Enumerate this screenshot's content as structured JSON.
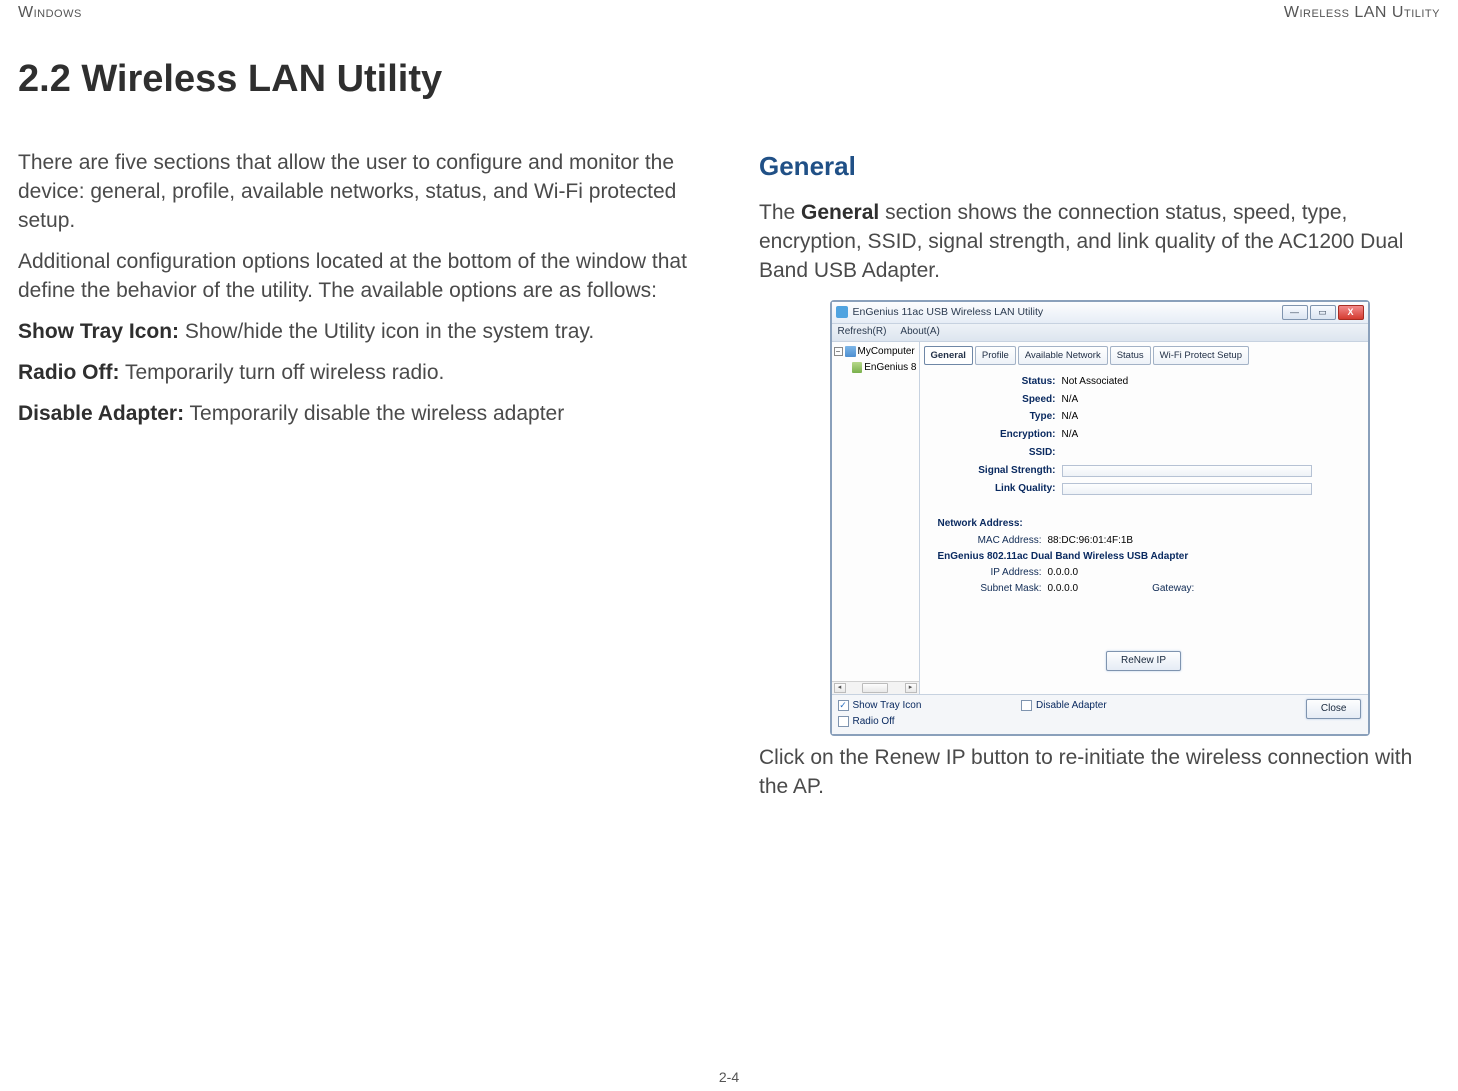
{
  "header": {
    "left": "Windows",
    "right": "Wireless LAN Utility"
  },
  "title": "2.2 Wireless LAN Utility",
  "left_col": {
    "intro": "There are five sections that allow the user to configure and monitor the device: general, profile, available networks, status, and Wi-Fi protected setup.",
    "additional": "Additional configuration options located at the bottom of the window that define the behavior of the utility. The available options are as follows:",
    "opt1_label": "Show Tray Icon:",
    "opt1_text": " Show/hide the Utility icon in the system tray.",
    "opt2_label": "Radio Off:",
    "opt2_text": " Temporarily turn off wireless radio.",
    "opt3_label": "Disable Adapter:",
    "opt3_text": " Temporarily disable the wireless adapter"
  },
  "right_col": {
    "heading": "General",
    "desc_pre": "The ",
    "desc_bold": "General",
    "desc_post": " section shows the connection status, speed, type, encryption, SSID, signal strength, and link quality of the AC1200 Dual Band USB Adapter.",
    "caption": "Click on the Renew IP button to re-initiate the wireless connection with the AP."
  },
  "window": {
    "title": "EnGenius 11ac USB Wireless LAN Utility",
    "menu": {
      "refresh": "Refresh(R)",
      "about": "About(A)"
    },
    "win_controls": {
      "min": "—",
      "max": "▭",
      "close": "X"
    },
    "tree": {
      "root_toggle": "−",
      "root": "MyComputer",
      "child": "EnGenius 8"
    },
    "scroll": {
      "left": "◂",
      "right": "▸"
    },
    "tabs": [
      "General",
      "Profile",
      "Available Network",
      "Status",
      "Wi-Fi Protect Setup"
    ],
    "status": {
      "Status": "Not Associated",
      "Speed": "N/A",
      "Type": "N/A",
      "Encryption": "N/A",
      "SSID": "",
      "SignalStrength_label": "Signal Strength:",
      "LinkQuality_label": "Link Quality:"
    },
    "network": {
      "heading": "Network Address:",
      "mac_label": "MAC Address:",
      "mac": "88:DC:96:01:4F:1B",
      "adapter": "EnGenius 802.11ac Dual Band Wireless USB Adapter",
      "ip_label": "IP Address:",
      "ip": "0.0.0.0",
      "subnet_label": "Subnet Mask:",
      "subnet": "0.0.0.0",
      "gateway_label": "Gateway:"
    },
    "buttons": {
      "renew": "ReNew IP",
      "close": "Close"
    },
    "checkboxes": {
      "show_tray": "Show Tray Icon",
      "radio_off": "Radio Off",
      "disable_adapter": "Disable Adapter"
    }
  },
  "footer": "2-4"
}
